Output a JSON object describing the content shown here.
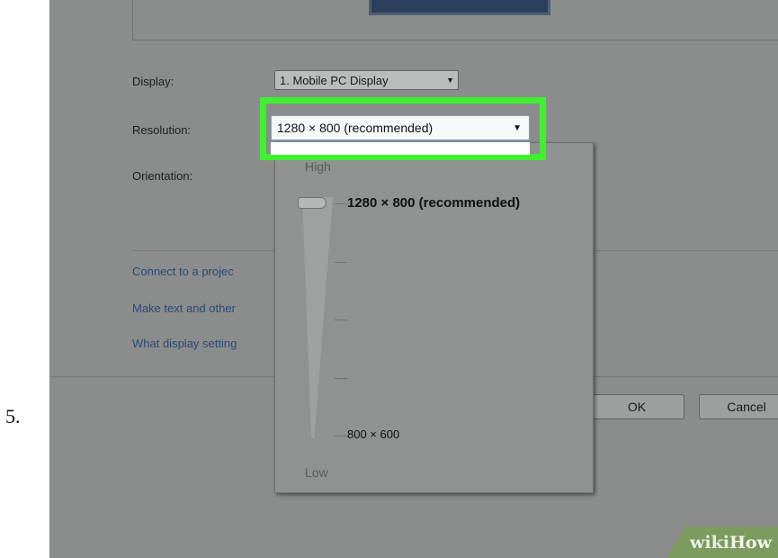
{
  "step": {
    "number": "5."
  },
  "display": {
    "label": "Display:",
    "value": "1. Mobile PC Display"
  },
  "resolution": {
    "label": "Resolution:",
    "value": "1280 × 800 (recommended)"
  },
  "orientation": {
    "label": "Orientation:"
  },
  "links": [
    {
      "text": "Connect to a projec"
    },
    {
      "text": "Make text and other"
    },
    {
      "text": "What display setting"
    }
  ],
  "buttons": {
    "ok": "OK",
    "cancel": "Cancel"
  },
  "resolution_slider": {
    "high_label": "High",
    "low_label": "Low",
    "max_option": "1280 × 800 (recommended)",
    "min_option": "800 × 600",
    "selected_position": 1.0
  },
  "watermark": {
    "part1": "wiki",
    "part2": "How"
  },
  "colors": {
    "highlight": "#3ef02e",
    "watermark": "#7c9b5e"
  }
}
